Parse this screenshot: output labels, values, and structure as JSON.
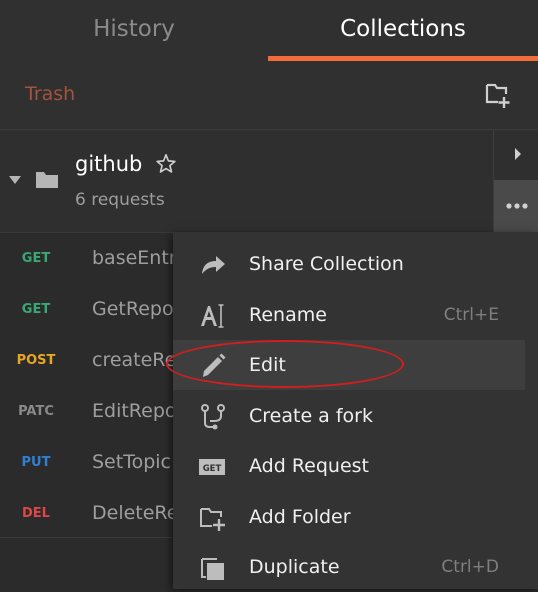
{
  "tabs": {
    "history": "History",
    "collections": "Collections"
  },
  "toolbar": {
    "trash": "Trash",
    "new_collection_icon": "new-collection-icon"
  },
  "collection": {
    "name": "github",
    "count": "6 requests"
  },
  "requests": [
    {
      "method": "GET",
      "name": "baseEntr",
      "color": "#3aa774"
    },
    {
      "method": "GET",
      "name": "GetRepo",
      "color": "#3aa774"
    },
    {
      "method": "POST",
      "name": "createRe",
      "color": "#e8a621"
    },
    {
      "method": "PATC",
      "name": "EditRepo",
      "color": "#8a8a8a"
    },
    {
      "method": "PUT",
      "name": "SetTopic",
      "color": "#2f7fd6"
    },
    {
      "method": "DEL",
      "name": "DeleteRe",
      "color": "#d94848"
    }
  ],
  "menu": {
    "items": [
      {
        "label": "Share Collection",
        "shortcut": "",
        "icon": "share-icon"
      },
      {
        "label": "Rename",
        "shortcut": "Ctrl+E",
        "icon": "rename-icon"
      },
      {
        "label": "Edit",
        "shortcut": "",
        "icon": "pencil-icon"
      },
      {
        "label": "Create a fork",
        "shortcut": "",
        "icon": "fork-icon"
      },
      {
        "label": "Add Request",
        "shortcut": "",
        "icon": "get-request-icon",
        "icon_text": "GET"
      },
      {
        "label": "Add Folder",
        "shortcut": "",
        "icon": "add-folder-icon"
      },
      {
        "label": "Duplicate",
        "shortcut": "Ctrl+D",
        "icon": "duplicate-icon"
      }
    ],
    "highlighted": "Edit"
  }
}
